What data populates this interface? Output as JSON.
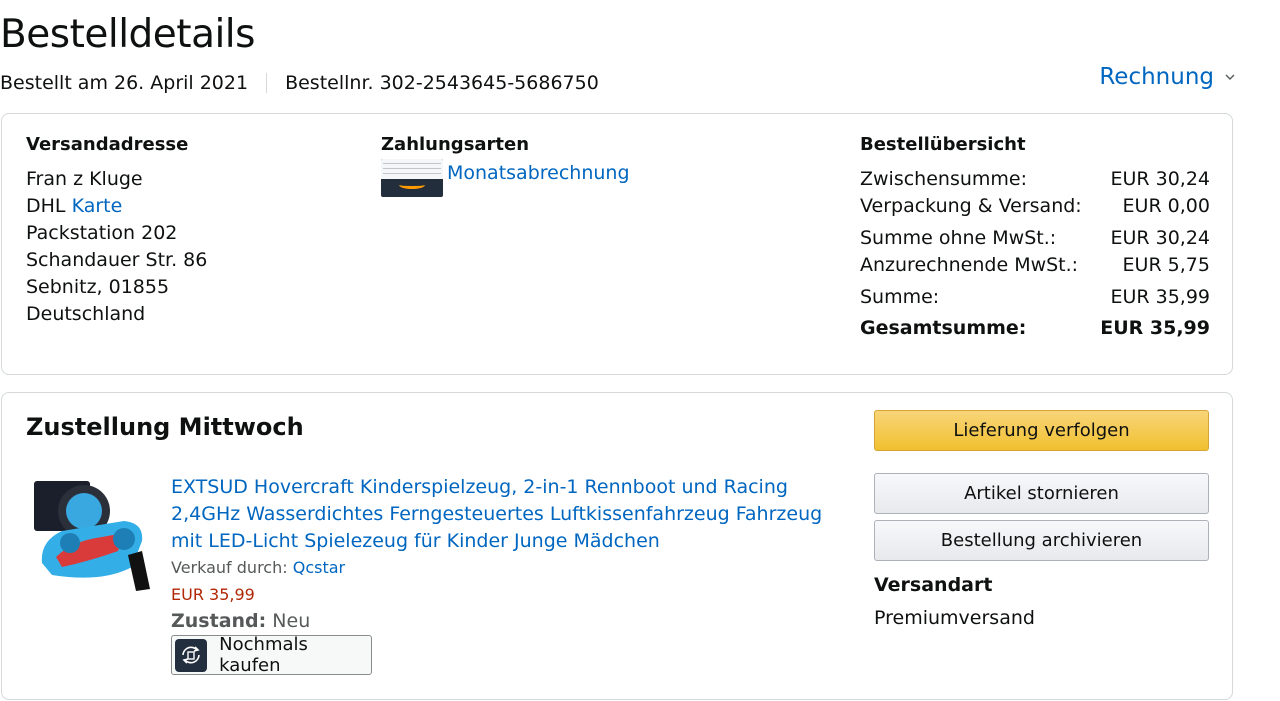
{
  "header": {
    "title": "Bestelldetails",
    "ordered_on": "Bestellt am 26. April 2021",
    "order_number": "Bestellnr. 302-2543645-5686750",
    "invoice_label": "Rechnung"
  },
  "shipping_address": {
    "heading": "Versandadresse",
    "name": "Fran z Kluge",
    "carrier": "DHL",
    "map_link": "Karte",
    "line1": "Packstation 202",
    "line2": "Schandauer Str. 86",
    "line3": "Sebnitz, 01855",
    "country": "Deutschland"
  },
  "payment": {
    "heading": "Zahlungsarten",
    "method": "Monatsabrechnung",
    "card_icon": "amazon-card-icon"
  },
  "summary": {
    "heading": "Bestellübersicht",
    "rows": [
      {
        "label": "Zwischensumme:",
        "value": "EUR 30,24"
      },
      {
        "label": "Verpackung & Versand:",
        "value": "EUR 0,00"
      },
      {
        "label": "Summe ohne MwSt.:",
        "value": "EUR 30,24"
      },
      {
        "label": "Anzurechnende MwSt.:",
        "value": "EUR 5,75"
      },
      {
        "label": "Summe:",
        "value": "EUR 35,99"
      }
    ],
    "total": {
      "label": "Gesamtsumme:",
      "value": "EUR 35,99"
    }
  },
  "delivery": {
    "title": "Zustellung Mittwoch",
    "product": {
      "title": "EXTSUD Hovercraft Kinderspielzeug, 2-in-1 Rennboot und Racing 2,4GHz Wasserdichtes Ferngesteuertes Luftkissenfahrzeug Fahrzeug mit LED-Licht Spielezeug für Kinder Junge Mädchen",
      "seller_prefix": "Verkauf durch:",
      "seller": "Qcstar",
      "price": "EUR 35,99",
      "condition_label": "Zustand:",
      "condition": "Neu",
      "buy_again": "Nochmals kaufen",
      "image": "hovercraft-toy-image"
    },
    "actions": {
      "track": "Lieferung verfolgen",
      "cancel": "Artikel stornieren",
      "archive": "Bestellung archivieren"
    },
    "shipping_method_heading": "Versandart",
    "shipping_method": "Premiumversand"
  },
  "colors": {
    "link": "#0066c0",
    "price": "#b12704",
    "primary_button": "#f5c649",
    "border": "#d5d9d9"
  }
}
